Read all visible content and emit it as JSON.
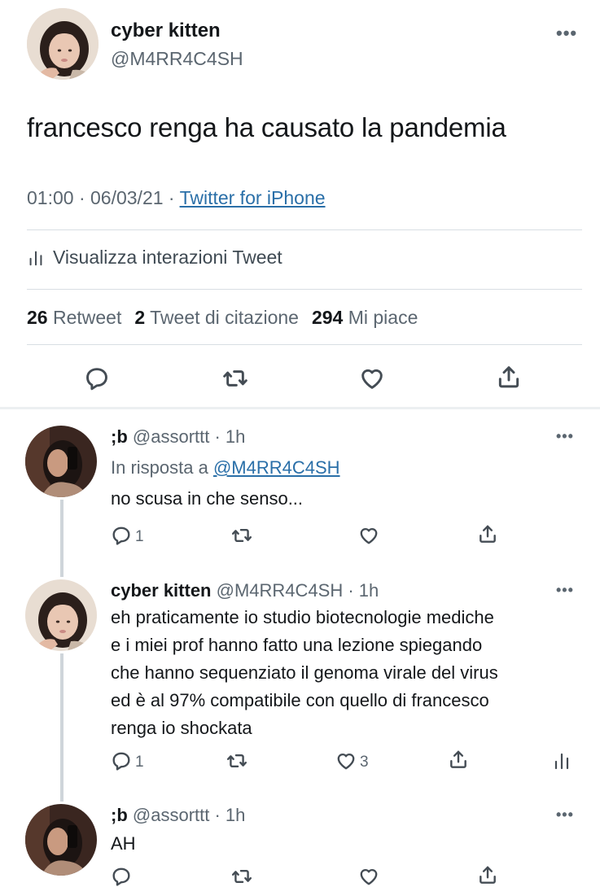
{
  "main_tweet": {
    "author_name": "cyber kitten",
    "author_handle": "@M4RR4C4SH",
    "text": "francesco renga ha causato la pandemia",
    "time_date": "01:00 · 06/03/21 · ",
    "source": "Twitter for iPhone",
    "interactions_label": "Visualizza interazioni Tweet",
    "stats": {
      "retweets_count": "26",
      "retweets_label": "Retweet",
      "quotes_count": "2",
      "quotes_label": "Tweet di citazione",
      "likes_count": "294",
      "likes_label": "Mi piace"
    },
    "more_label": "•••"
  },
  "replies": [
    {
      "name": ";b",
      "handle": "@assorttt",
      "time": "· 1h",
      "reply_to_prefix": "In risposta a ",
      "reply_to_handle": "@M4RR4C4SH",
      "text": "no scusa in che senso...",
      "reply_count": "1",
      "like_count": ""
    },
    {
      "name": "cyber kitten",
      "handle": "@M4RR4C4SH",
      "time": "· 1h",
      "text_lines": [
        "eh praticamente io studio biotecnologie mediche",
        "e i miei prof hanno fatto una lezione spiegando",
        "che hanno sequenziato il genoma virale del virus",
        "ed è al 97% compatibile con quello di francesco",
        "renga io shockata"
      ],
      "reply_count": "1",
      "like_count": "3"
    },
    {
      "name": ";b",
      "handle": "@assorttt",
      "time": "· 1h",
      "text": "AH"
    }
  ],
  "icons": [
    "reply-icon",
    "retweet-icon",
    "like-icon",
    "share-icon",
    "analytics-icon",
    "more-icon"
  ],
  "colors": {
    "link": "#2a6fa8",
    "secondary_text": "#5b6670",
    "primary_text": "#14171a",
    "divider": "#d8dee3"
  }
}
